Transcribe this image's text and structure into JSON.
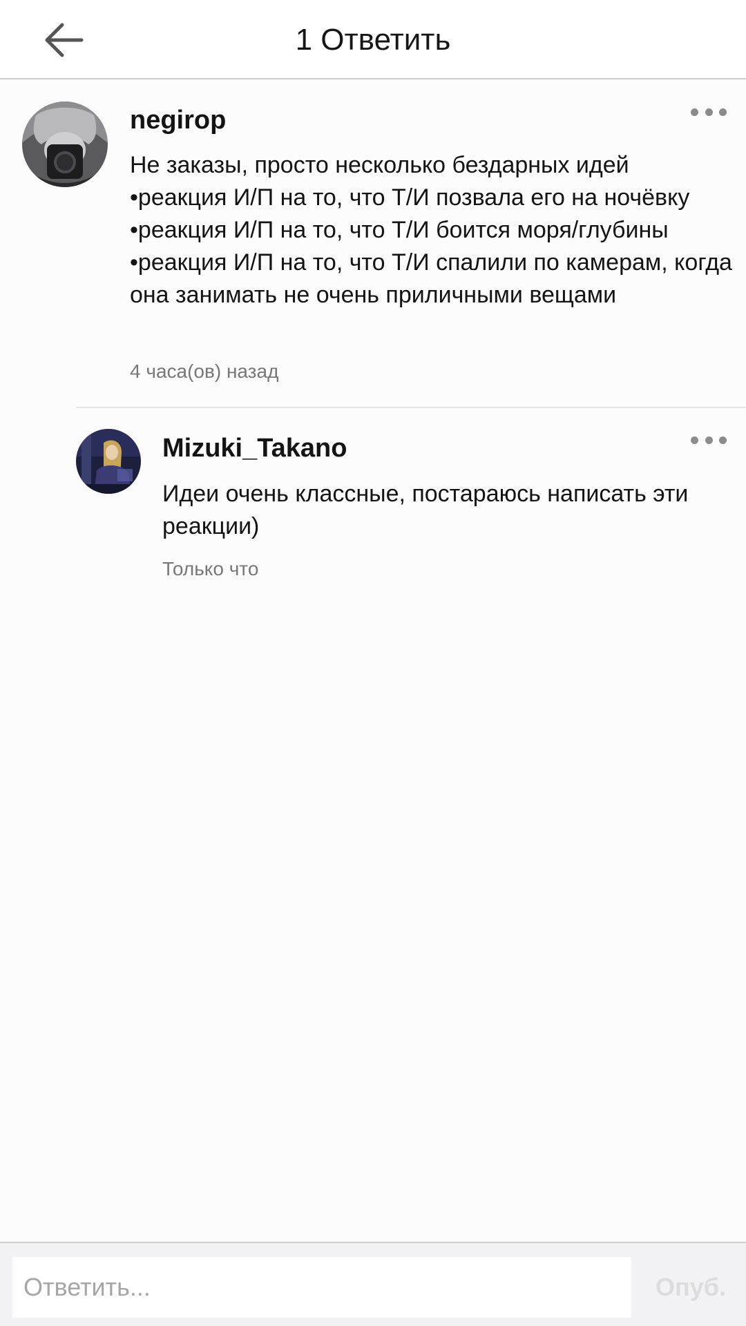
{
  "header": {
    "title": "1 Ответить",
    "back_icon": "arrow-left-icon"
  },
  "comments": [
    {
      "username": "negirop",
      "text": "Не заказы, просто несколько бездарных идей\n•реакция И/П на то, что Т/И позвала его на ночёвку\n•реакция И/П на то, что Т/И боится моря/глубины\n•реакция И/П на то, что Т/И спалили по камерам, когда она занимать не очень приличными вещами",
      "timestamp": "4 часа(ов) назад"
    }
  ],
  "replies": [
    {
      "username": "Mizuki_Takano",
      "text": "Идеи очень классные, постараюсь написать эти реакции)",
      "timestamp": "Только что"
    }
  ],
  "composer": {
    "placeholder": "Ответить...",
    "value": "",
    "publish_label": "Опуб."
  },
  "colors": {
    "accent_disabled": "#dcdcdc",
    "text_primary": "#141414",
    "text_secondary": "#777777"
  }
}
